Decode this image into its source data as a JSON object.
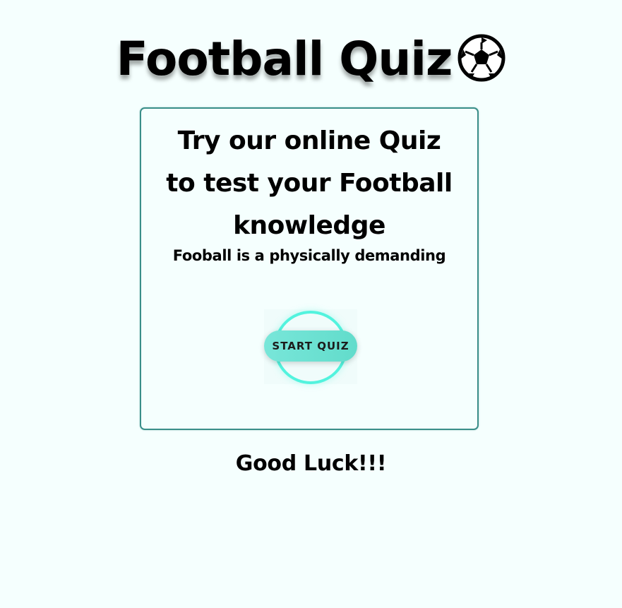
{
  "header": {
    "title": "Football Quiz",
    "icon": "soccer-ball-icon"
  },
  "card": {
    "headline_line1": "Try our online Quiz",
    "headline_line2": "to test your Football",
    "headline_line3": "knowledge",
    "subtitle": "Fooball is a physically demanding",
    "start_button_label": "START QUIZ"
  },
  "footer": {
    "message": "Good Luck!!!"
  },
  "colors": {
    "background": "#f5fffe",
    "card_border": "#3a8e89",
    "button_fill": "#6ee2d3",
    "ring": "#52f3de"
  }
}
